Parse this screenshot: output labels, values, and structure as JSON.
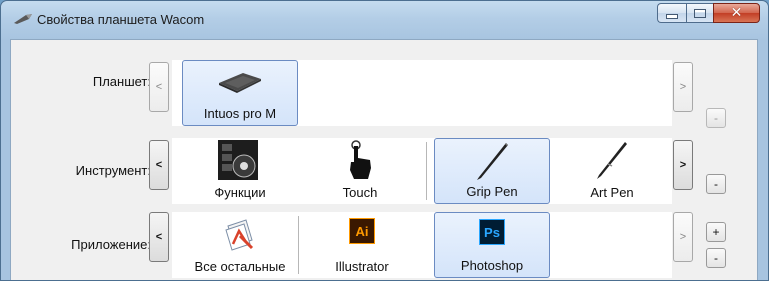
{
  "window": {
    "title": "Свойства планшета Wacom",
    "buttons": {
      "minimize": "minimize-icon",
      "maximize": "maximize-icon",
      "close": "close-icon"
    }
  },
  "rows": {
    "tablet": {
      "label": "Планшет:",
      "prev": "<",
      "next": ">",
      "remove": "-",
      "items": [
        {
          "label": "Intuos pro M",
          "icon": "tablet-icon"
        }
      ]
    },
    "tool": {
      "label": "Инструмент:",
      "prev": "<",
      "next": ">",
      "remove": "-",
      "items": [
        {
          "label": "Функции",
          "icon": "functions-icon"
        },
        {
          "label": "Touch",
          "icon": "touch-icon"
        },
        {
          "label": "Grip Pen",
          "icon": "grip-pen-icon"
        },
        {
          "label": "Art Pen",
          "icon": "art-pen-icon"
        }
      ]
    },
    "app": {
      "label": "Приложение:",
      "prev": "<",
      "next": ">",
      "add": "+",
      "remove": "-",
      "items": [
        {
          "label": "Все остальные",
          "icon": "all-apps-icon"
        },
        {
          "label": "Illustrator",
          "icon": "illustrator-icon",
          "badge": "Ai",
          "color": "#ff9a00"
        },
        {
          "label": "Photoshop",
          "icon": "photoshop-icon",
          "badge": "Ps",
          "color": "#2aa7ff"
        }
      ]
    }
  }
}
